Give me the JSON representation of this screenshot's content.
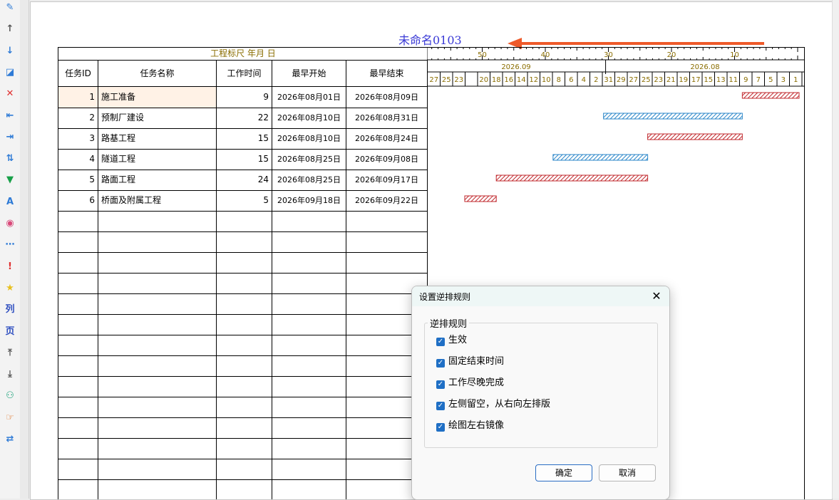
{
  "toolbar": {
    "icons": [
      {
        "name": "pen-icon",
        "glyph": "✎",
        "color": "#2f7bd6"
      },
      {
        "name": "arrow-up-icon",
        "glyph": "↑",
        "color": "#555555"
      },
      {
        "name": "arrow-down-icon",
        "glyph": "↓",
        "color": "#2f7bd6"
      },
      {
        "name": "edit-icon",
        "glyph": "◪",
        "color": "#2f7bd6"
      },
      {
        "name": "delete-icon",
        "glyph": "✕",
        "color": "#e03030"
      },
      {
        "name": "outdent-icon",
        "glyph": "⇤",
        "color": "#2f7bd6"
      },
      {
        "name": "indent-icon",
        "glyph": "⇥",
        "color": "#2f7bd6"
      },
      {
        "name": "sort-icon",
        "glyph": "⇅",
        "color": "#2f7bd6"
      },
      {
        "name": "filter-icon",
        "glyph": "▼",
        "color": "#18a048"
      },
      {
        "name": "font-icon",
        "glyph": "A",
        "color": "#2f7bd6"
      },
      {
        "name": "palette-icon",
        "glyph": "◉",
        "color": "#d94a7a"
      },
      {
        "name": "more-icon",
        "glyph": "⋯",
        "color": "#2f7bd6"
      },
      {
        "name": "alert-icon",
        "glyph": "!",
        "color": "#e03030"
      },
      {
        "name": "star-icon",
        "glyph": "★",
        "color": "#e8c020"
      },
      {
        "name": "column-icon",
        "glyph": "列",
        "color": "#2f4fc0"
      },
      {
        "name": "page-icon",
        "glyph": "页",
        "color": "#2f4fc0"
      },
      {
        "name": "move-top-icon",
        "glyph": "⤒",
        "color": "#555555"
      },
      {
        "name": "move-bottom-icon",
        "glyph": "⤓",
        "color": "#555555"
      },
      {
        "name": "users-icon",
        "glyph": "⚇",
        "color": "#18a078"
      },
      {
        "name": "hand-point-icon",
        "glyph": "☞",
        "color": "#e07020"
      },
      {
        "name": "swap-icon",
        "glyph": "⇄",
        "color": "#2f7bd6"
      }
    ]
  },
  "document": {
    "title": "未命名0103"
  },
  "table": {
    "ruler_label": "工程标尺 年月 日",
    "headers": [
      "任务ID",
      "任务名称",
      "工作时间",
      "最早开始",
      "最早结束"
    ],
    "rows": [
      {
        "id": "1",
        "name": "施工准备",
        "duration": "9",
        "start": "2026年08月01日",
        "end": "2026年08月09日"
      },
      {
        "id": "2",
        "name": "预制厂建设",
        "duration": "22",
        "start": "2026年08月10日",
        "end": "2026年08月31日"
      },
      {
        "id": "3",
        "name": "路基工程",
        "duration": "15",
        "start": "2026年08月10日",
        "end": "2026年08月24日"
      },
      {
        "id": "4",
        "name": "隧道工程",
        "duration": "15",
        "start": "2026年08月25日",
        "end": "2026年09月08日"
      },
      {
        "id": "5",
        "name": "路面工程",
        "duration": "24",
        "start": "2026年08月25日",
        "end": "2026年09月17日"
      },
      {
        "id": "6",
        "name": "桥面及附属工程",
        "duration": "5",
        "start": "2026年09月18日",
        "end": "2026年09月22日"
      }
    ],
    "empty_rows": 14
  },
  "gantt": {
    "day_counter_labels": [
      "50",
      "40",
      "30",
      "20",
      "10"
    ],
    "month_labels": [
      "2026.09",
      "2026.08"
    ],
    "day_labels": [
      "27",
      "25",
      "23",
      "",
      "20",
      "18",
      "16",
      "14",
      "12",
      "10",
      "8",
      "6",
      "4",
      "2",
      "31",
      "29",
      "27",
      "25",
      "23",
      "21",
      "19",
      "17",
      "15",
      "13",
      "11",
      "9",
      "7",
      "5",
      "3",
      "1"
    ],
    "colors": {
      "critical": "#c0282d",
      "normal": "#2a86c8",
      "ruler_text": "#8a6d00"
    }
  },
  "dialog": {
    "title": "设置逆排规则",
    "group_label": "逆排规则",
    "options": [
      {
        "label": "生效",
        "checked": true
      },
      {
        "label": "固定结束时间",
        "checked": true
      },
      {
        "label": "工作尽晚完成",
        "checked": true
      },
      {
        "label": "左侧留空，从右向左排版",
        "checked": true
      },
      {
        "label": "绘图左右镜像",
        "checked": true
      }
    ],
    "ok_label": "确定",
    "cancel_label": "取消"
  }
}
